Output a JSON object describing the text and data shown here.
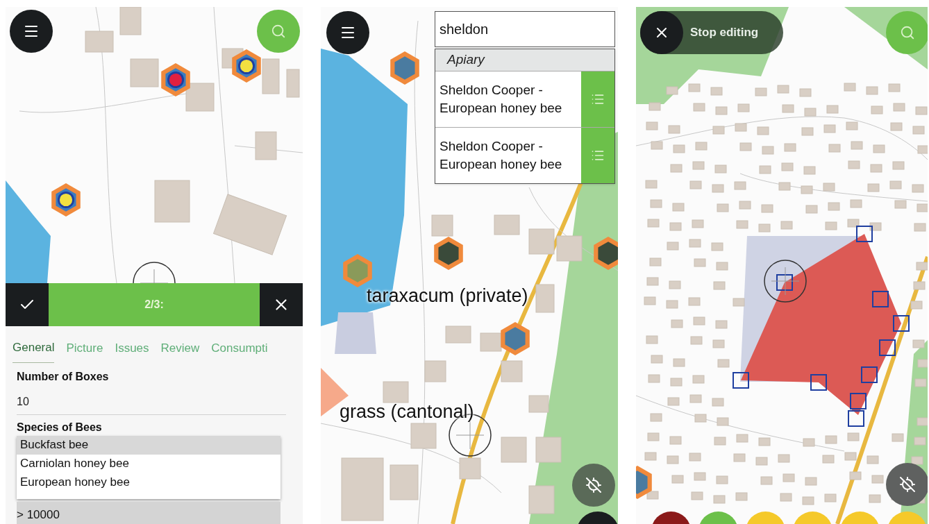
{
  "form_screen": {
    "toolbar": {
      "title": "2/3:"
    },
    "tabs": [
      {
        "label": "General",
        "selected": true
      },
      {
        "label": "Picture",
        "selected": false
      },
      {
        "label": "Issues",
        "selected": false
      },
      {
        "label": "Review",
        "selected": false
      },
      {
        "label": "Consumpti",
        "selected": false
      }
    ],
    "fields": [
      {
        "kind": "text",
        "label": "Number of Boxes",
        "value": "10"
      },
      {
        "kind": "list",
        "label": "Species of Bees",
        "options": [
          {
            "label": "Buckfast bee",
            "selected": true
          },
          {
            "label": "Carniolan honey bee",
            "selected": false
          },
          {
            "label": "European honey bee",
            "selected": false
          }
        ]
      },
      {
        "kind": "select",
        "value": "> 10000"
      }
    ]
  },
  "search_screen": {
    "search": {
      "value": "sheldon"
    },
    "group": "Apiary",
    "results": [
      {
        "text": "Sheldon Cooper - European honey bee"
      },
      {
        "text": "Sheldon Cooper - European honey bee"
      }
    ],
    "map_labels": [
      "taraxacum (private)",
      "grass (cantonal)"
    ]
  },
  "edit_screen": {
    "stop_button": "Stop editing",
    "color_buttons": [
      {
        "color": "#8b1a1a"
      },
      {
        "color": "#6cc04a"
      },
      {
        "color": "#f5c92a"
      },
      {
        "color": "#f5c92a"
      },
      {
        "color": "#f5c92a"
      },
      {
        "color": "#f5c92a"
      }
    ]
  }
}
